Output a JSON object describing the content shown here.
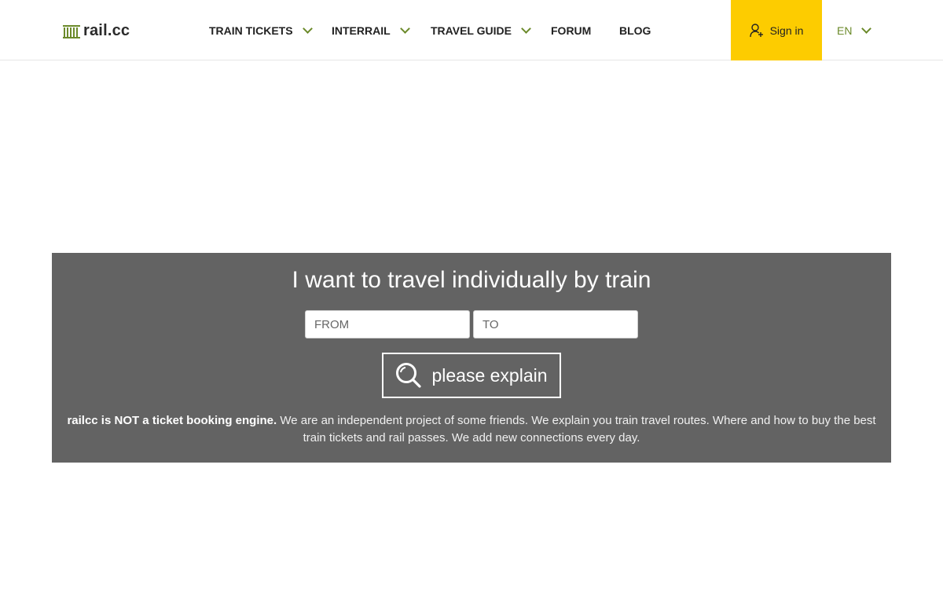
{
  "header": {
    "logo_text": "rail.cc",
    "nav": [
      {
        "label": "TRAIN TICKETS",
        "dropdown": true
      },
      {
        "label": "INTERRAIL",
        "dropdown": true
      },
      {
        "label": "TRAVEL GUIDE",
        "dropdown": true
      },
      {
        "label": "FORUM",
        "dropdown": false
      },
      {
        "label": "BLOG",
        "dropdown": false
      }
    ],
    "signin_label": "Sign in",
    "language": "EN"
  },
  "search": {
    "title": "I want to travel individually by train",
    "from_placeholder": "FROM",
    "to_placeholder": "TO",
    "button_label": "please explain",
    "disclaimer_bold": "railcc is NOT a ticket booking engine.",
    "disclaimer_text": " We are an independent project of some friends. We explain you train travel routes. Where and how to buy the best train tickets and rail passes. We add new connections every day."
  },
  "colors": {
    "accent_yellow": "#fdcc00",
    "accent_green": "#6b8a2a",
    "panel_gray": "#636363"
  },
  "icons": {
    "logo": "train-logo-icon",
    "signin": "user-plus-icon",
    "search": "magnifier-icon",
    "dropdown": "chevron-down-icon"
  }
}
